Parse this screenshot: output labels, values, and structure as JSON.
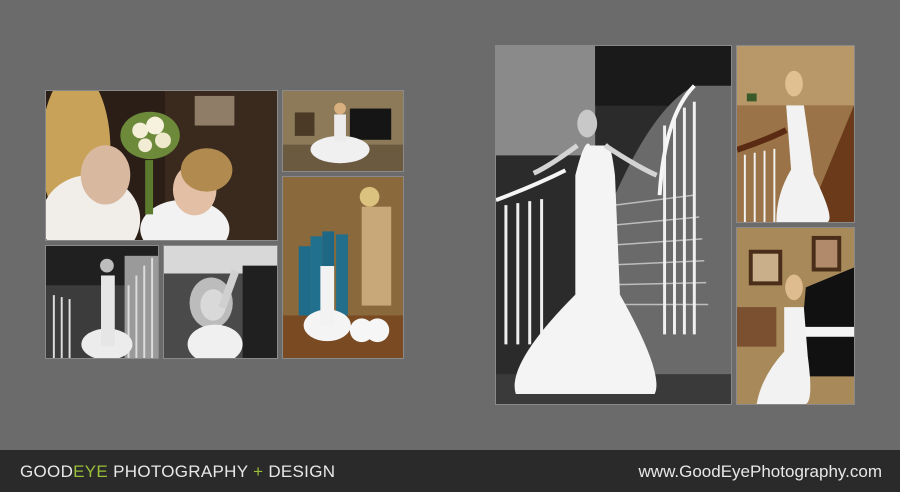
{
  "footer": {
    "brand_good": "GOOD",
    "brand_eye": "EYE",
    "brand_photo": " PHOTOGRAPHY ",
    "brand_plus": "+",
    "brand_design": " DESIGN",
    "website": "www.GoodEyePhotography.com"
  },
  "colors": {
    "background": "#6b6b6b",
    "footer": "#2a2a2a",
    "accent_green": "#9bbf3a"
  }
}
